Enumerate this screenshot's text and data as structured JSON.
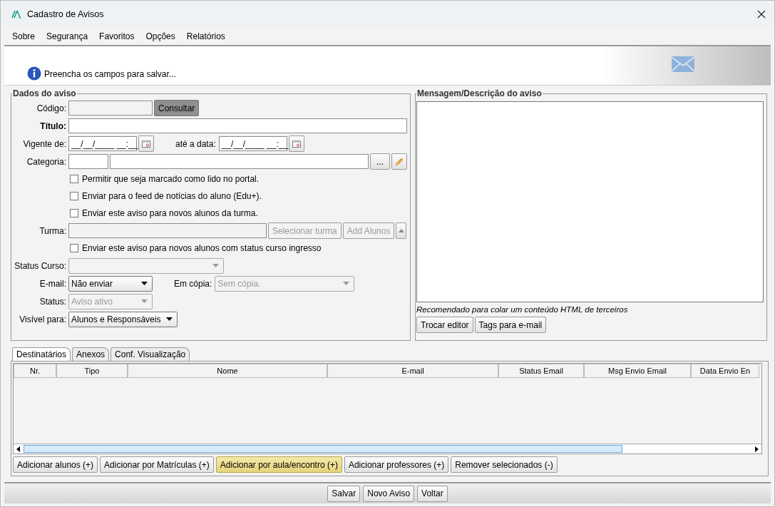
{
  "window": {
    "title": "Cadastro de Avisos"
  },
  "menu": [
    "Sobre",
    "Segurança",
    "Favoritos",
    "Opções",
    "Relatórios"
  ],
  "banner": {
    "message": "Preencha os campos para salvar..."
  },
  "dados": {
    "legend": "Dados do aviso",
    "codigo": {
      "label": "Código:",
      "button": "Consultar"
    },
    "titulo": {
      "label": "Título:"
    },
    "vigente": {
      "label": "Vigente de:",
      "value": "__/__/____ __:__",
      "ate_label": "até a data:",
      "ate_value": "__/__/____ __:__"
    },
    "categoria": {
      "label": "Categoria:",
      "browse": "..."
    },
    "checks": [
      {
        "label": "Permitir que seja marcado como lido no portal.",
        "checked": false
      },
      {
        "label": "Enviar para o feed de notícias do aluno (Edu+).",
        "checked": false
      },
      {
        "label": "Enviar este aviso para novos alunos da turma.",
        "checked": false
      }
    ],
    "turma": {
      "label": "Turma:",
      "buttons": [
        {
          "label": "Selecionar turma",
          "disabled": true
        },
        {
          "label": "Add Alunos",
          "disabled": true
        }
      ]
    },
    "check_ingresso": {
      "label": "Enviar este aviso para novos alunos com status curso ingresso",
      "checked": false
    },
    "selects": [
      {
        "label": "Status Curso:",
        "disabled": true
      },
      {
        "label": "E-mail:",
        "value": "Não enviar",
        "disabled": false,
        "copy": {
          "label": "Em cópia:",
          "value": "Sem cópia.",
          "disabled": true
        }
      },
      {
        "label": "Status:",
        "value": "Aviso ativo",
        "disabled": true
      },
      {
        "label": "Visível para:",
        "value": "Alunos e Responsáveis",
        "disabled": false
      }
    ]
  },
  "mensagem": {
    "legend": "Mensagem/Descrição do aviso",
    "hint": "Recomendado para colar um conteúdo HTML de terceiros",
    "buttons": [
      "Trocar editor",
      "Tags para e-mail"
    ]
  },
  "tabs": [
    {
      "label": "Destinatários",
      "selected": true
    },
    {
      "label": "Anexos",
      "selected": false
    },
    {
      "label": "Conf. Visualização",
      "selected": false
    }
  ],
  "table": {
    "columns": [
      "Nr.",
      "Tipo",
      "Nome",
      "E-mail",
      "Status Email",
      "Msg Envio Email",
      "Data Envio En"
    ]
  },
  "actions": [
    {
      "label": "Adicionar alunos (+)",
      "focused": false
    },
    {
      "label": "Adicionar por Matrículas (+)",
      "focused": false
    },
    {
      "label": "Adicionar por aula/encontro (+)",
      "focused": true
    },
    {
      "label": "Adicionar professores (+)",
      "focused": false
    },
    {
      "label": "Remover selecionados (-)",
      "focused": false
    }
  ],
  "footer": [
    "Salvar",
    "Novo Aviso",
    "Voltar"
  ]
}
